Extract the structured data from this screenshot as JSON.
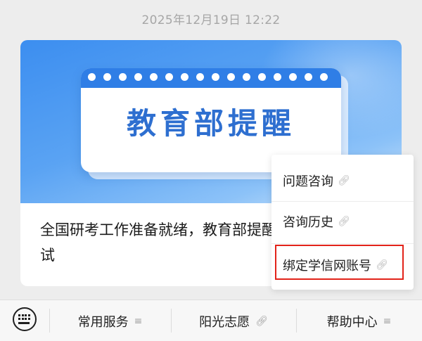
{
  "timestamp": "2025年12月19日 12:22",
  "article": {
    "banner_title": "教育部提醒",
    "text": "全国研考工作准备就绪，教育部提醒广大考生诚信考试"
  },
  "popup_menu": {
    "items": [
      {
        "label": "问题咨询",
        "icon": "link-icon"
      },
      {
        "label": "咨询历史",
        "icon": "link-icon"
      },
      {
        "label": "绑定学信网账号",
        "icon": "link-icon",
        "highlighted": true
      }
    ],
    "highlight_color": "#e2231a"
  },
  "bottom_bar": {
    "keyboard_icon": "keyboard-icon",
    "items": [
      {
        "label": "常用服务",
        "icon": "menu-lines-icon"
      },
      {
        "label": "阳光志愿",
        "icon": "link-icon"
      },
      {
        "label": "帮助中心",
        "icon": "menu-lines-icon"
      }
    ]
  },
  "colors": {
    "accent_blue": "#2e6fd0",
    "background": "#ededed"
  }
}
